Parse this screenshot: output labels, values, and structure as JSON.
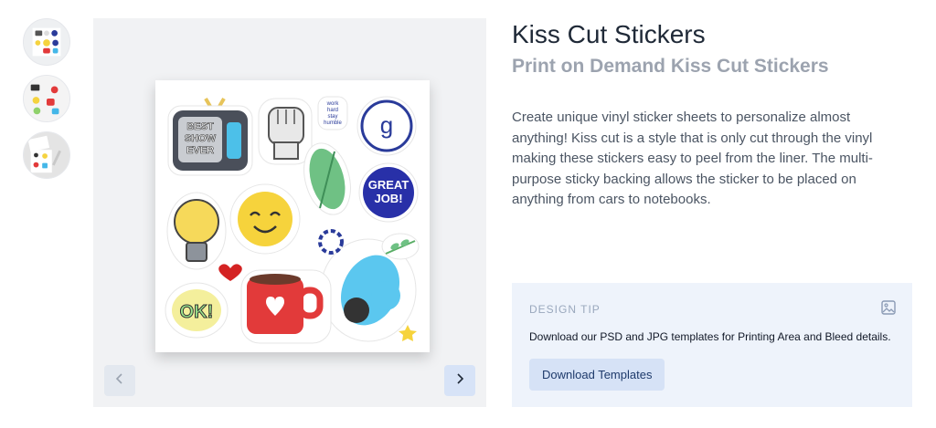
{
  "product": {
    "title": "Kiss Cut Stickers",
    "subtitle": "Print on Demand Kiss Cut Stickers",
    "description": "Create unique vinyl sticker sheets to personalize almost anything! Kiss cut is a style that is only cut through the vinyl making these stickers easy to peel from the liner. The multi-purpose sticky backing allows the sticker to be placed on anything from cars to notebooks."
  },
  "gallery": {
    "thumbnails": [
      "thumbnail-sticker-sheet",
      "thumbnail-sticker-closeup",
      "thumbnail-sticker-lifestyle"
    ],
    "sticker_texts": {
      "tv": [
        "BEST",
        "SHOW",
        "EVER"
      ],
      "small_script": [
        "work",
        "hard",
        "stay",
        "humble"
      ],
      "g_logo": "g",
      "great_job": [
        "GREAT",
        "JOB!"
      ],
      "ok": "OK!"
    },
    "prev_icon": "chevron-left-icon",
    "next_icon": "chevron-right-icon"
  },
  "design_tip": {
    "label": "DESIGN TIP",
    "icon": "image-icon",
    "text": "Download our PSD and JPG templates for Printing Area and Bleed details.",
    "button_label": "Download Templates"
  },
  "colors": {
    "tip_background": "#eef3fb",
    "button_background": "#d6e2f6",
    "title": "#1f2937",
    "subtitle": "#9ca3af"
  }
}
